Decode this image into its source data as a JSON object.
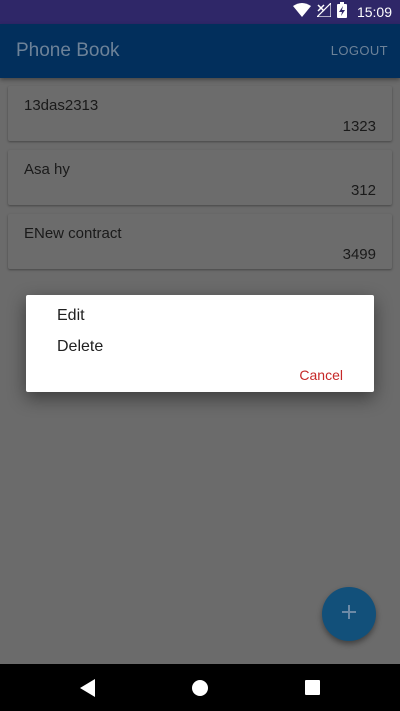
{
  "status_bar": {
    "time": "15:09",
    "icons": [
      "wifi-icon",
      "no-signal-icon",
      "battery-charging-icon"
    ],
    "background": "#2f2768"
  },
  "app_bar": {
    "title": "Phone Book",
    "logout_label": "LOGOUT",
    "background": "#022f5c"
  },
  "contacts": [
    {
      "name": "13das2313",
      "number": "1323"
    },
    {
      "name": "Asa hy",
      "number": "312"
    },
    {
      "name": "ENew contract",
      "number": "3499"
    }
  ],
  "dialog": {
    "items": [
      "Edit",
      "Delete"
    ],
    "cancel_label": "Cancel",
    "cancel_color": "#c62828"
  },
  "fab": {
    "icon": "plus-icon",
    "color": "#12507a"
  },
  "nav_bar": {
    "icons": [
      "back-icon",
      "home-icon",
      "recents-icon"
    ]
  }
}
